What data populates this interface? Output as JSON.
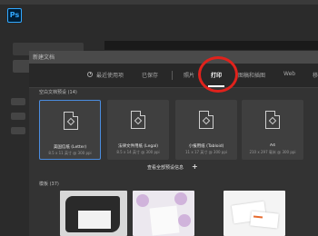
{
  "app": {
    "logo_text": "Ps"
  },
  "dialog": {
    "title": "新建文档"
  },
  "tabs": [
    {
      "label": "最近使用项",
      "active": false
    },
    {
      "label": "已保存",
      "active": false
    },
    {
      "label": "照片",
      "active": false
    },
    {
      "label": "打印",
      "active": true
    },
    {
      "label": "图稿和插图",
      "active": false
    },
    {
      "label": "Web",
      "active": false
    },
    {
      "label": "移",
      "active": false
    }
  ],
  "blank_presets": {
    "heading": "空白文档预设 (14)",
    "items": [
      {
        "name": "美国信纸 (Letter)",
        "dims": "8.5 x 11 英寸 @ 300 ppi",
        "selected": true
      },
      {
        "name": "法律文件用纸 (Legal)",
        "dims": "8.5 x 14 英寸 @ 300 ppi",
        "selected": false
      },
      {
        "name": "小报用纸 (Tabloid)",
        "dims": "11 x 17 英寸 @ 300 ppi",
        "selected": false
      },
      {
        "name": "A4",
        "dims": "210 x 297 毫米 @ 300 ppi",
        "selected": false
      }
    ],
    "see_all_label": "查看全部预设信息",
    "see_all_icon": "+"
  },
  "templates": {
    "heading": "模板 (37)"
  },
  "colors": {
    "accent": "#4b8de0",
    "highlight_circle": "#e0221c",
    "ps_blue": "#31a8ff"
  }
}
